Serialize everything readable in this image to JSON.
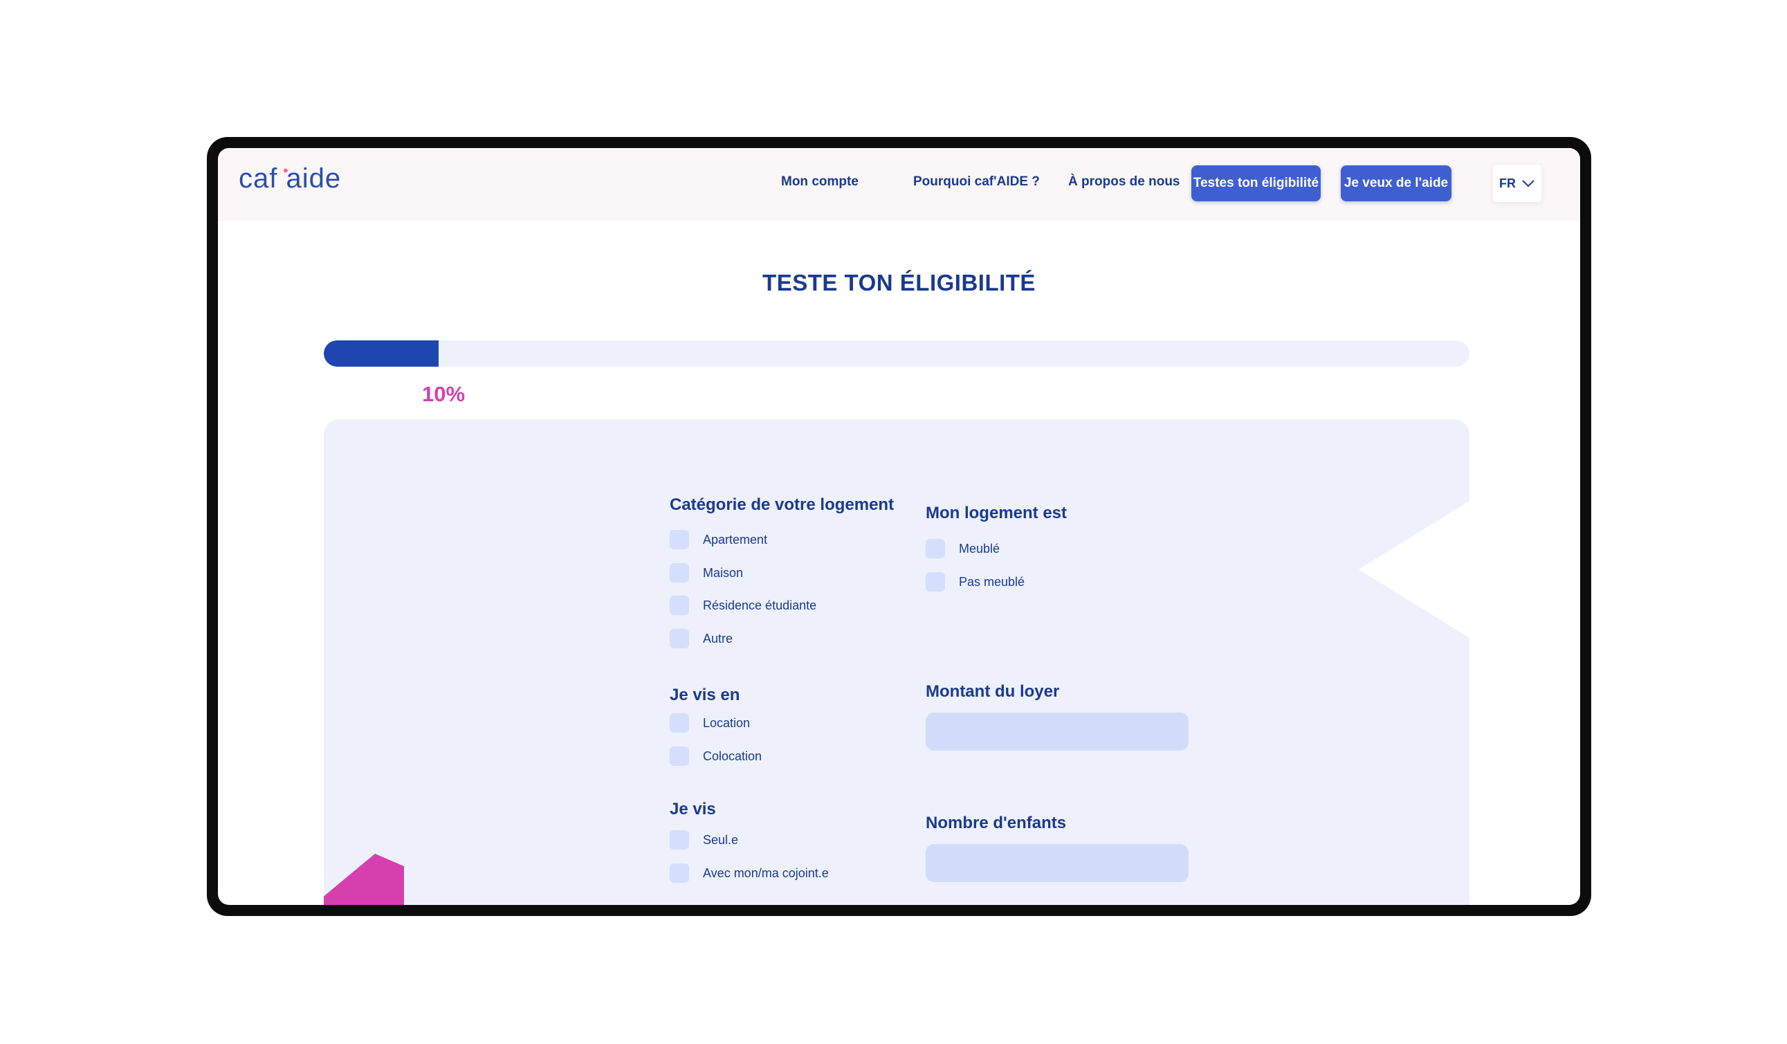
{
  "header": {
    "logo": "caf aide",
    "nav": [
      "Mon compte",
      "Pourquoi caf'AIDE ?",
      "À propos de nous"
    ],
    "buttons": [
      "Testes ton éligibilité",
      "Je veux de l'aide"
    ],
    "language": "FR"
  },
  "page": {
    "title": "TESTE TON ÉLIGIBILITÉ",
    "progress_value": 0.1,
    "progress_label": "10%"
  },
  "form": {
    "categorie": {
      "title": "Catégorie de votre logement",
      "options": [
        "Apartement",
        "Maison",
        "Résidence étudiante",
        "Autre"
      ]
    },
    "logement": {
      "title": "Mon logement est",
      "options": [
        "Meublé",
        "Pas meublé"
      ]
    },
    "vis_en": {
      "title": "Je vis en",
      "options": [
        "Location",
        "Colocation"
      ]
    },
    "vis": {
      "title": "Je vis",
      "options": [
        "Seul.e",
        "Avec mon/ma cojoint.e"
      ]
    },
    "loyer": {
      "title": "Montant du loyer",
      "value": ""
    },
    "enfants": {
      "title": "Nombre d'enfants",
      "value": ""
    }
  },
  "colors": {
    "primary": "#1a3a8f",
    "button": "#3f5fd0",
    "progress": "#1f45b0",
    "accent_pink": "#d63fae",
    "panel": "#eef1fc",
    "checkbox": "#d5defa"
  },
  "icons": [
    "chevron-down-icon",
    "logo-star-icon"
  ]
}
